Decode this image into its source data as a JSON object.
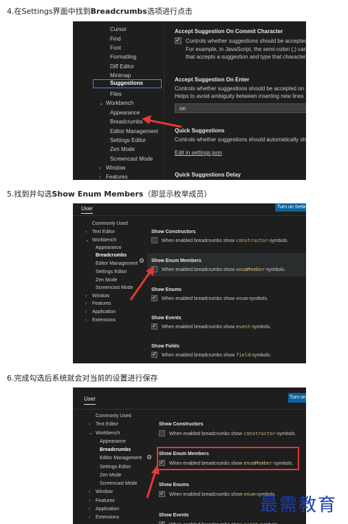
{
  "steps": {
    "s4": {
      "pre": "4.在Settings界面中找到",
      "bold": "Breadcrumbs",
      "post": "选项进行点击"
    },
    "s5": {
      "pre": "5.找到并勾选",
      "bold": "Show Enum Members",
      "post": "（即显示枚举成员）"
    },
    "s6": {
      "text": "6.完成勾选后系统就会对当前的设置进行保存"
    }
  },
  "shot1": {
    "nav": [
      "Cursor",
      "Find",
      "Font",
      "Formatting",
      "Diff Editor",
      "Minimap",
      "Suggestions",
      "Files",
      "Workbench",
      "Appearance",
      "Breadcrumbs",
      "Editor Management",
      "Settings Editor",
      "Zen Mode",
      "Screencast Mode",
      "Window",
      "Features"
    ],
    "acc": {
      "title": "Accept Suggestion On Commit Character",
      "l1": "Controls whether suggestions should be accepted",
      "l2": "For example, in JavaScript, the semi-colon (;) can",
      "l3": "that accepts a suggestion and type that character"
    },
    "enter": {
      "title": "Accept Suggestion On Enter",
      "l1": "Controls whether suggestions should be accepted on e",
      "l2": "Helps to avoid ambiguity between inserting new lines",
      "select": "on"
    },
    "quick": {
      "title": "Quick Suggestions",
      "l1": "Controls whether suggestions should automatically sho",
      "link": "Edit in settings.json"
    },
    "delay": {
      "title": "Quick Suggestions Delay"
    }
  },
  "shot2": {
    "tab": "User",
    "sync": "Turn on Settings",
    "nav": [
      "Commonly Used",
      "Text Editor",
      "Workbench",
      "Appearance",
      "Breadcrumbs",
      "Editor Management",
      "Settings Editor",
      "Zen Mode",
      "Screencast Mode",
      "Window",
      "Features",
      "Application",
      "Extensions"
    ],
    "desc_pre": "When enabled breadcrumbs show",
    "desc_post": "-symbols.",
    "items": [
      {
        "title": "Show Constructors",
        "code": "constructor"
      },
      {
        "title": "Show Enum Members",
        "code": "enumMember"
      },
      {
        "title": "Show Enums",
        "code": "enum"
      },
      {
        "title": "Show Events",
        "code": "event"
      },
      {
        "title": "Show Fields",
        "code": "field"
      }
    ]
  },
  "shot3": {
    "tab": "User",
    "sync": "Turn on",
    "nav": [
      "Commonly Used",
      "Text Editor",
      "Workbench",
      "Appearance",
      "Breadcrumbs",
      "Editor Management",
      "Settings Editor",
      "Zen Mode",
      "Screencast Mode",
      "Window",
      "Features",
      "Application",
      "Extensions"
    ],
    "items": [
      {
        "title": "Show Constructors",
        "code": "constructor"
      },
      {
        "title": "Show Enum Members",
        "code": "enumMember"
      },
      {
        "title": "Show Enums",
        "code": "enum"
      },
      {
        "title": "Show Events",
        "code": "event"
      }
    ]
  },
  "watermark": "最需教育",
  "colors": {
    "bg": "#1e1e1e",
    "accent": "#3794ff",
    "arrow": "#e53935",
    "watermark": "#1a3fb0"
  }
}
